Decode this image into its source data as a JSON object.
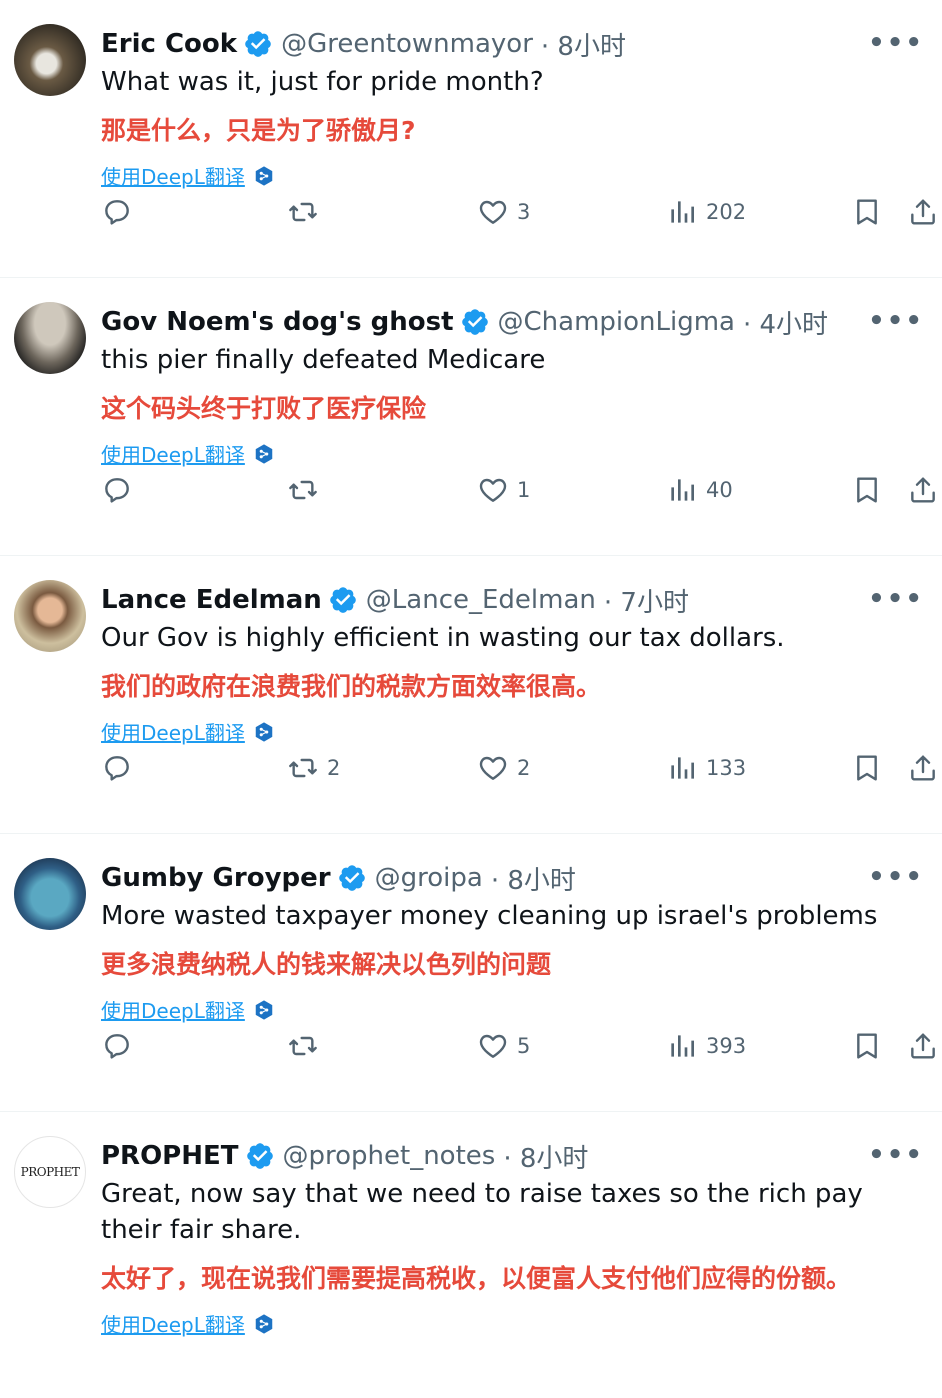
{
  "translate_label": "使用DeepL翻译",
  "tweets": [
    {
      "name": "Eric Cook",
      "handle": "@Greentownmayor",
      "time": "· 8小时",
      "text": "What was it, just for pride month?",
      "translation": "那是什么，只是为了骄傲月?",
      "replies": "",
      "retweets": "",
      "likes": "3",
      "views": "202"
    },
    {
      "name": "Gov Noem's dog's ghost",
      "handle": "@ChampionLigma",
      "time": "· 4小时",
      "text": "this pier finally defeated Medicare",
      "translation": "这个码头终于打败了医疗保险",
      "replies": "",
      "retweets": "",
      "likes": "1",
      "views": "40"
    },
    {
      "name": "Lance Edelman",
      "handle": "@Lance_Edelman",
      "time": "· 7小时",
      "text": "Our Gov is highly efficient in wasting our tax dollars.",
      "translation": "我们的政府在浪费我们的税款方面效率很高。",
      "replies": "",
      "retweets": "2",
      "likes": "2",
      "views": "133"
    },
    {
      "name": "Gumby Groyper",
      "handle": "@groipa",
      "time": "· 8小时",
      "text": "More wasted taxpayer money cleaning up israel's problems",
      "translation": "更多浪费纳税人的钱来解决以色列的问题",
      "replies": "",
      "retweets": "",
      "likes": "5",
      "views": "393"
    },
    {
      "name": "PROPHET",
      "handle": "@prophet_notes",
      "time": "· 8小时",
      "avatar_text": "PROPHET",
      "text": "Great, now say that we need to raise taxes so the rich pay their fair share.",
      "translation": "太好了，现在说我们需要提高税收，以便富人支付他们应得的份额。"
    }
  ],
  "colors": {
    "verified": "#1d9bf0",
    "translation": "#e64a3b",
    "muted": "#536471",
    "link": "#1d9bf0"
  },
  "icons": [
    "verified-badge-icon",
    "more-icon",
    "reply-icon",
    "retweet-icon",
    "like-icon",
    "views-icon",
    "bookmark-icon",
    "share-icon",
    "deepl-icon"
  ]
}
